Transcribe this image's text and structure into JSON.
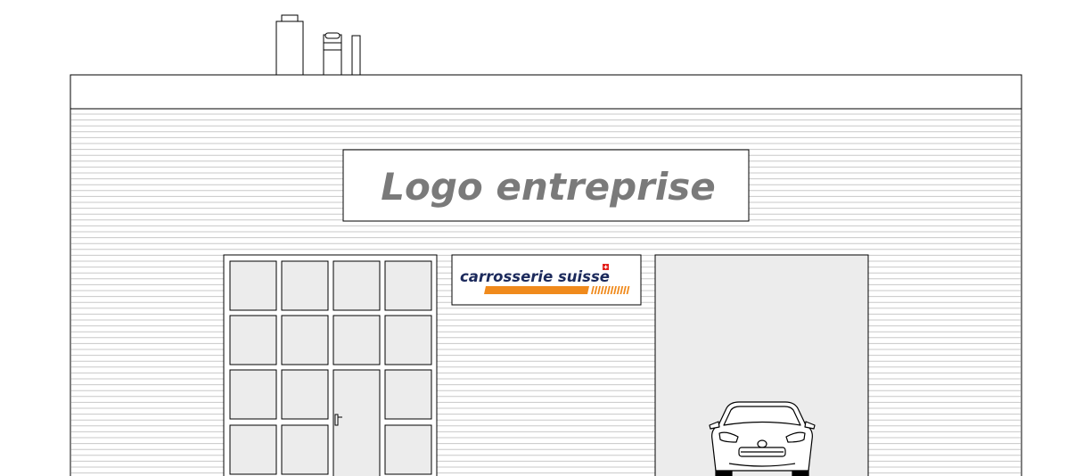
{
  "signs": {
    "company_logo_text": "Logo entreprise",
    "brand_logo_text": "carrosserie suisse"
  },
  "colors": {
    "line": "#000000",
    "facade": "#ffffff",
    "siding_line": "#c8c8c8",
    "panel_fill": "#ececec",
    "company_text": "#7a7a7a",
    "brand_text": "#1c2a5c",
    "brand_stripe": "#f08a1c",
    "swiss_red": "#e3201b"
  }
}
